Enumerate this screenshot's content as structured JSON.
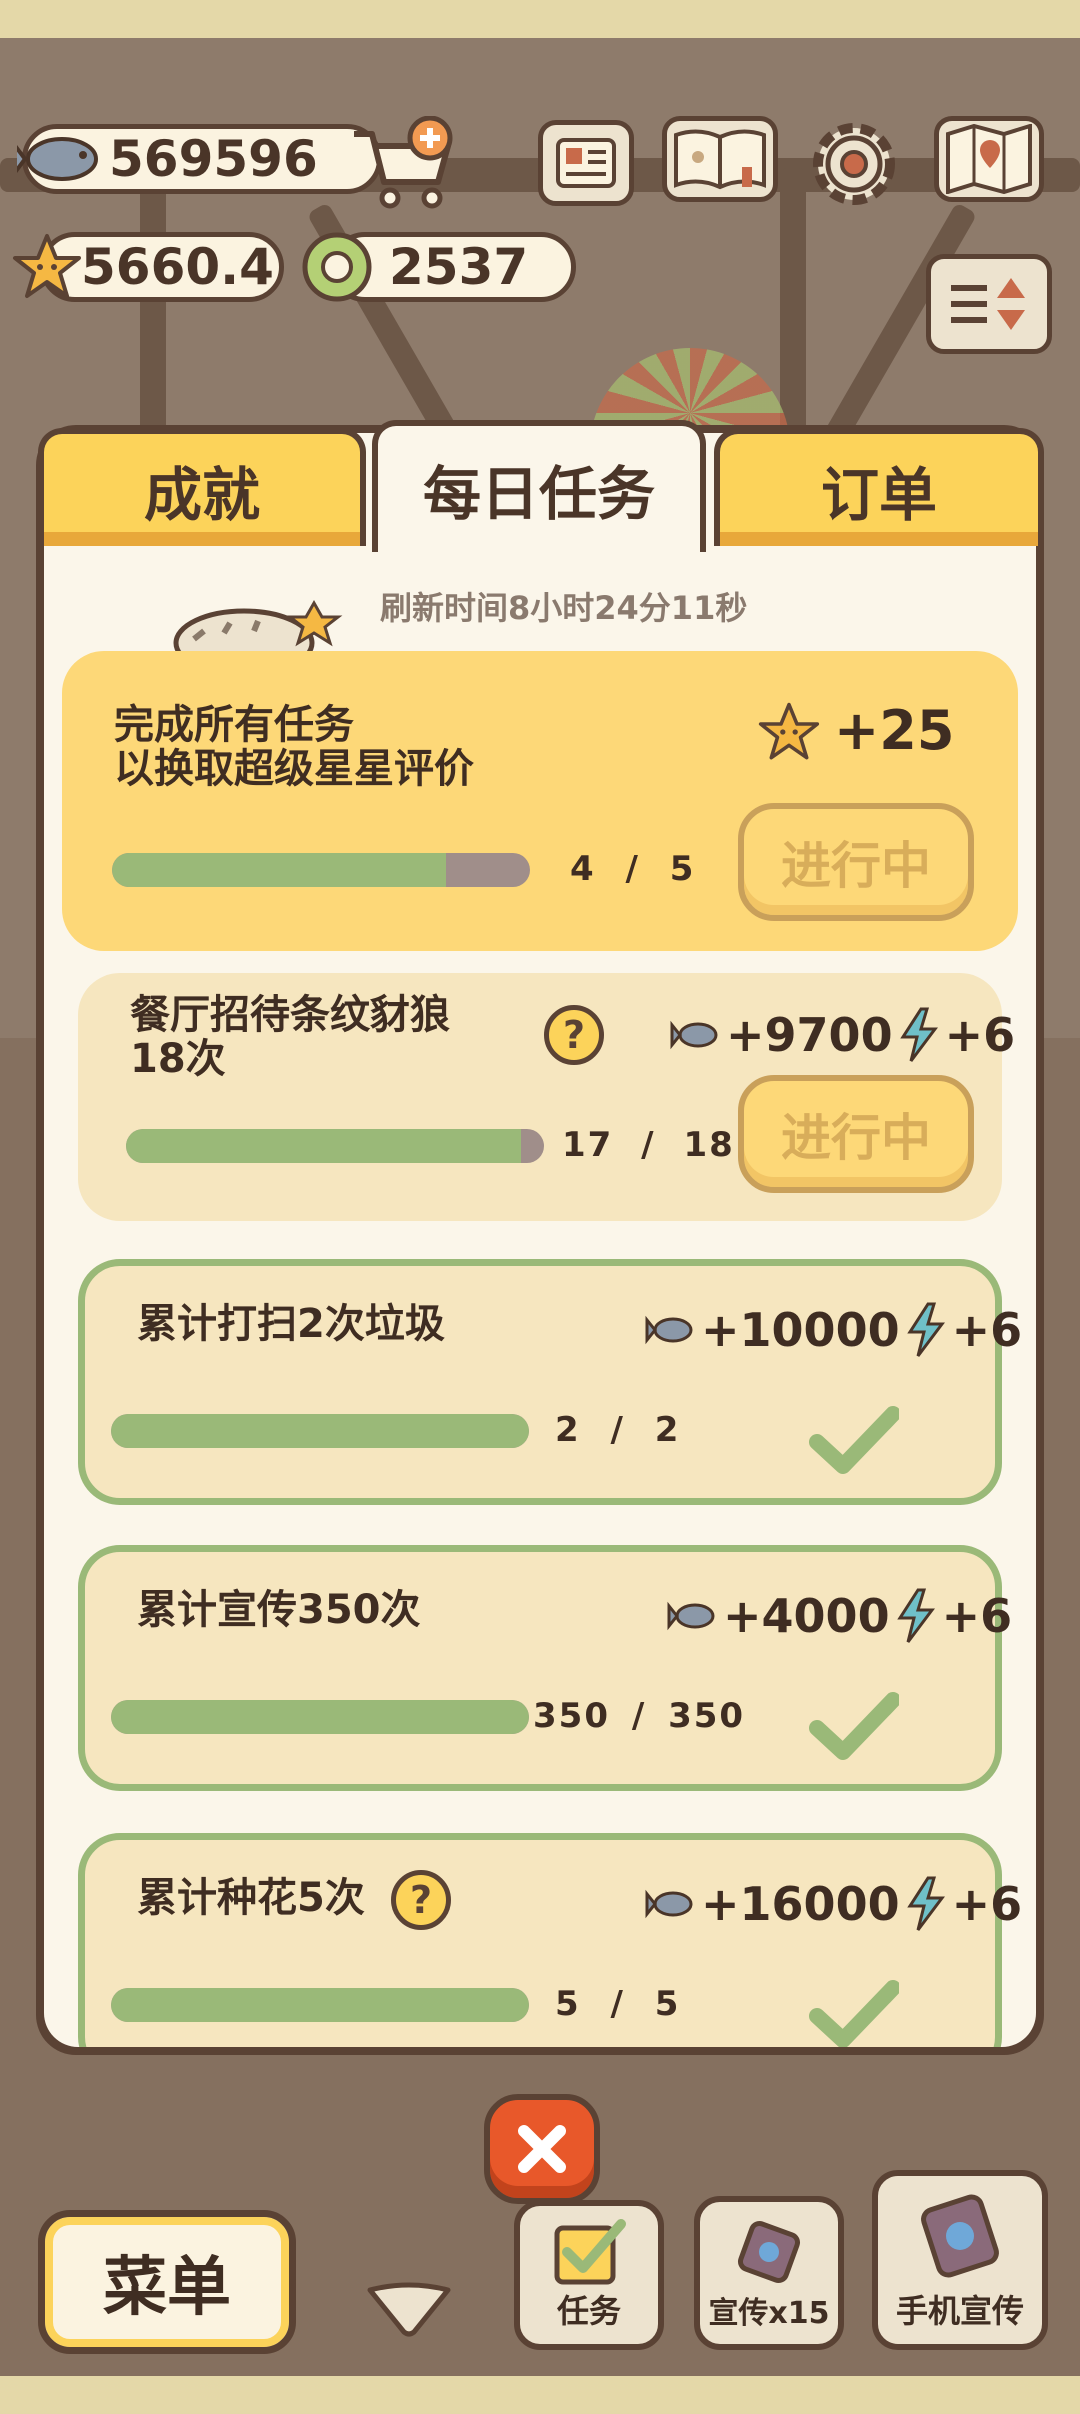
{
  "resources": {
    "fish": "569596",
    "stars": "5660.4",
    "coins": "2537"
  },
  "tabs": {
    "achievements": "成就",
    "daily_tasks": "每日任务",
    "orders": "订单"
  },
  "refresh_text": "刷新时间8小时24分11秒",
  "main_task": {
    "title_line1": "完成所有任务",
    "title_line2": "以换取超级星星评价",
    "reward": "+25",
    "progress": "4",
    "total": "5",
    "progress_fraction": 0.8,
    "button": "进行中"
  },
  "tasks": [
    {
      "title_line1": "餐厅招待条纹豺狼",
      "title_line2": "18次",
      "fish": "+9700",
      "energy": "+6",
      "progress": "17",
      "total": "18",
      "progress_fraction": 0.944,
      "button": "进行中",
      "status": "in_progress"
    },
    {
      "title_line1": "累计打扫2次垃圾",
      "fish": "+10000",
      "energy": "+6",
      "progress": "2",
      "total": "2",
      "progress_fraction": 1.0,
      "status": "done"
    },
    {
      "title_line1": "累计宣传350次",
      "fish": "+4000",
      "energy": "+6",
      "progress": "350",
      "total": "350",
      "progress_fraction": 1.0,
      "status": "done"
    },
    {
      "title_line1": "累计种花5次",
      "fish": "+16000",
      "energy": "+6",
      "progress": "5",
      "total": "5",
      "progress_fraction": 1.0,
      "status": "done"
    }
  ],
  "separator": "/",
  "help_glyph": "?",
  "bottom": {
    "menu": "菜单",
    "task": "任务",
    "promote": "宣传x15",
    "phone_promote": "手机宣传"
  },
  "colors": {
    "accent_yellow": "#fcd35a",
    "progress_green": "#9ab978",
    "border_brown": "#5a4234",
    "close_orange": "#e8582a"
  }
}
